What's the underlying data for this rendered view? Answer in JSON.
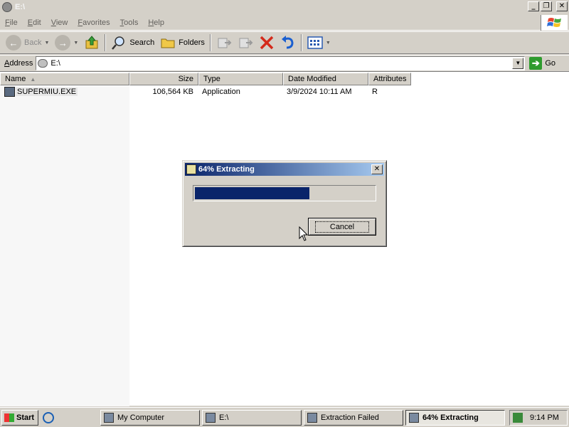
{
  "window": {
    "title": "E:\\"
  },
  "menu": [
    "File",
    "Edit",
    "View",
    "Favorites",
    "Tools",
    "Help"
  ],
  "toolbar": {
    "back": "Back",
    "search": "Search",
    "folders": "Folders"
  },
  "address": {
    "label": "Address",
    "value": "E:\\",
    "go": "Go"
  },
  "columns": {
    "name": "Name",
    "size": "Size",
    "type": "Type",
    "date": "Date Modified",
    "attributes": "Attributes"
  },
  "files": [
    {
      "name": "SUPERMIU.EXE",
      "size": "106,564 KB",
      "type": "Application",
      "date": "3/9/2024 10:11 AM",
      "attributes": "R"
    }
  ],
  "dialog": {
    "title": "64% Extracting",
    "progress": 0.64,
    "cancel": "Cancel"
  },
  "taskbar": {
    "start": "Start",
    "tasks": [
      "My Computer",
      "E:\\",
      "Extraction Failed",
      "64% Extracting"
    ],
    "clock": "9:14 PM"
  },
  "colors": {
    "titlebar_gradient_start": "#0a246a",
    "progress_fill": "#0a246a",
    "face": "#d4d0c8"
  }
}
